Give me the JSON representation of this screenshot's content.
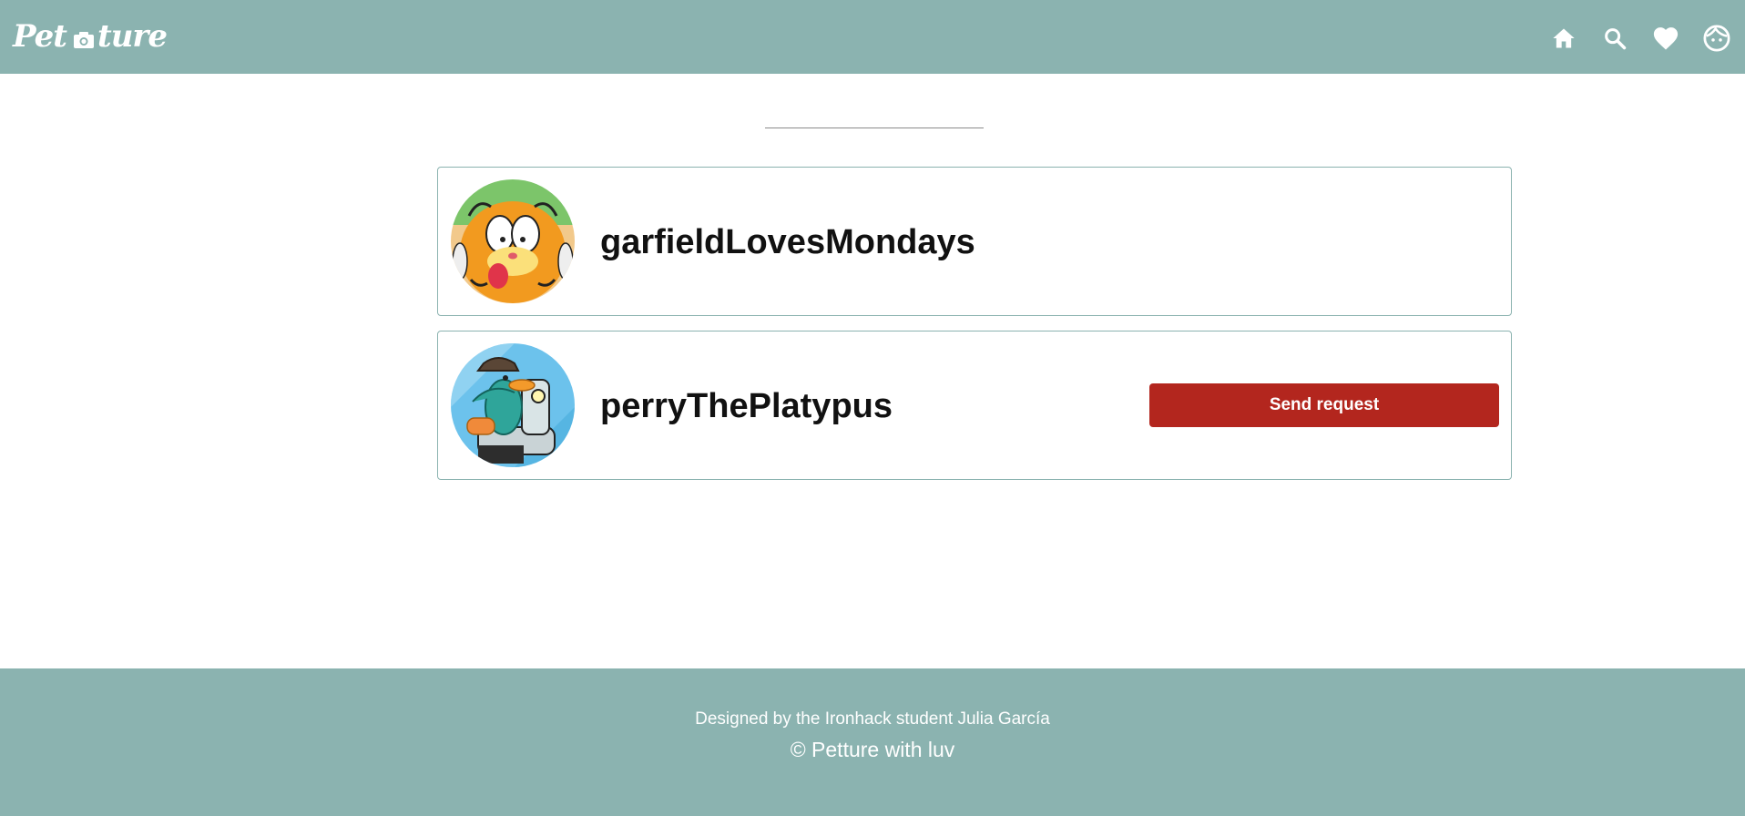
{
  "header": {
    "logo_left": "Pet",
    "logo_right": "ture",
    "logo_camera_icon": "camera-icon",
    "nav_icons": [
      "home-icon",
      "search-icon",
      "heart-icon",
      "profile-face-icon"
    ],
    "background_color": "#8bb3b0"
  },
  "results": [
    {
      "username": "garfieldLovesMondays",
      "avatar_icon": "garfield-avatar",
      "has_request_button": false
    },
    {
      "username": "perryThePlatypus",
      "avatar_icon": "perry-avatar",
      "has_request_button": true,
      "request_button_label": "Send request"
    }
  ],
  "footer": {
    "credit": "Designed by the Ironhack student Julia García",
    "copyright": "© Petture with luv"
  },
  "colors": {
    "accent": "#8bb3b0",
    "button": "#b3261e",
    "text": "#111111"
  }
}
